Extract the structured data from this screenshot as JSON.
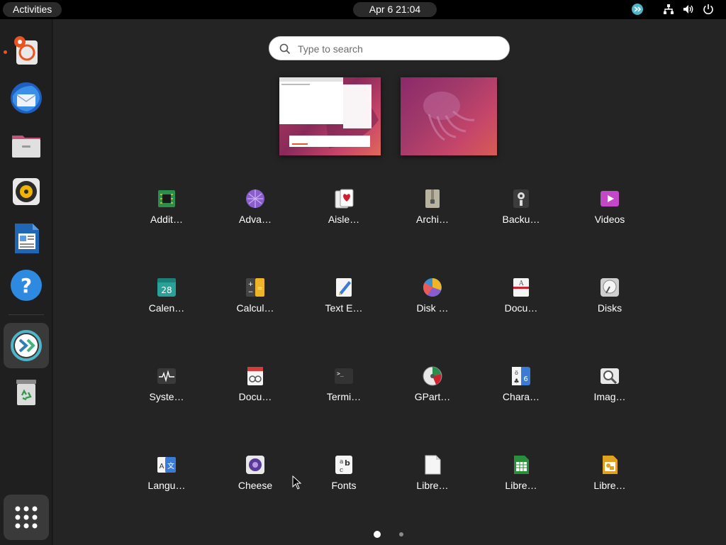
{
  "topbar": {
    "activities_label": "Activities",
    "clock": "Apr 6  21:04",
    "tray_icons": [
      "remote-desktop-icon",
      "network-icon",
      "volume-icon",
      "power-icon"
    ]
  },
  "dock": {
    "items": [
      {
        "name": "help-tools-icon",
        "running": true
      },
      {
        "name": "thunderbird-icon",
        "running": false
      },
      {
        "name": "files-icon",
        "running": false
      },
      {
        "name": "rhythmbox-icon",
        "running": false
      },
      {
        "name": "libreoffice-writer-icon",
        "running": false
      },
      {
        "name": "help-icon",
        "running": false
      },
      {
        "name": "remmina-icon",
        "running": true,
        "active": true
      },
      {
        "name": "trash-icon",
        "running": false
      }
    ],
    "show_apps": "app-grid-icon"
  },
  "search": {
    "placeholder": "Type to search"
  },
  "apps": [
    {
      "label": "Addit…",
      "icon": "additional-drivers-icon"
    },
    {
      "label": "Adva…",
      "icon": "advanced-network-icon"
    },
    {
      "label": "Aisle…",
      "icon": "aisleriot-icon"
    },
    {
      "label": "Archi…",
      "icon": "archive-manager-icon"
    },
    {
      "label": "Backu…",
      "icon": "backups-icon"
    },
    {
      "label": "Videos",
      "icon": "videos-icon"
    },
    {
      "label": "Calen…",
      "icon": "calendar-icon",
      "glyph": "28"
    },
    {
      "label": "Calcul…",
      "icon": "calculator-icon"
    },
    {
      "label": "Text E…",
      "icon": "text-editor-icon"
    },
    {
      "label": "Disk …",
      "icon": "disk-usage-icon"
    },
    {
      "label": "Docu…",
      "icon": "document-viewer-icon"
    },
    {
      "label": "Disks",
      "icon": "disks-icon"
    },
    {
      "label": "Syste…",
      "icon": "system-monitor-icon"
    },
    {
      "label": "Docu…",
      "icon": "document-scanner-icon"
    },
    {
      "label": "Termi…",
      "icon": "terminal-icon",
      "glyph": ">_"
    },
    {
      "label": "GPart…",
      "icon": "gparted-icon"
    },
    {
      "label": "Chara…",
      "icon": "characters-icon"
    },
    {
      "label": "Imag…",
      "icon": "image-viewer-icon"
    },
    {
      "label": "Langu…",
      "icon": "language-support-icon"
    },
    {
      "label": "Cheese",
      "icon": "cheese-icon"
    },
    {
      "label": "Fonts",
      "icon": "fonts-icon"
    },
    {
      "label": "Libre…",
      "icon": "libreoffice-icon"
    },
    {
      "label": "Libre…",
      "icon": "libreoffice-calc-icon"
    },
    {
      "label": "Libre…",
      "icon": "libreoffice-draw-icon"
    }
  ],
  "pages": {
    "current": 1,
    "total": 2
  },
  "colors": {
    "accent": "#e95420",
    "panel": "#000000",
    "overview": "#242424"
  }
}
